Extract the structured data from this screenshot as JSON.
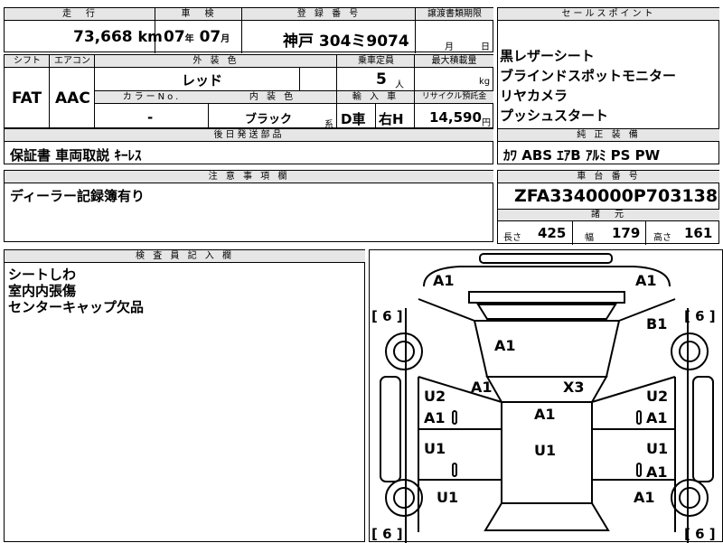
{
  "top": {
    "mileage_header": "走　行",
    "mileage_value": "73,668",
    "mileage_unit": "km",
    "inspection_header": "車　検",
    "inspection_year": "07",
    "inspection_year_unit": "年",
    "inspection_month": "07",
    "inspection_month_unit": "月",
    "registration_header": "登 録 番 号",
    "registration_value": "神戸 304ミ9074",
    "transfer_header": "譲渡書類期限",
    "transfer_month_unit": "月",
    "transfer_day_unit": "日"
  },
  "row2": {
    "shift_header": "シフト",
    "shift_value": "FAT",
    "ac_header": "エアコン",
    "ac_value": "AAC",
    "exterior_color_header": "外 装 色",
    "exterior_color_value": "レッド",
    "capacity_header": "乗車定員",
    "capacity_value": "5",
    "capacity_unit": "人",
    "max_load_header": "最大積載量",
    "max_load_unit": "kg",
    "color_no_header": "カラーNo.",
    "color_no_value": "-",
    "interior_color_header": "内 装 色",
    "interior_color_value": "ブラック",
    "interior_color_suffix": "系",
    "import_header": "輸 入 車",
    "import_value": "D車",
    "steering_value": "右H",
    "recycle_header": "リサイクル預託金",
    "recycle_value": "14,590",
    "recycle_unit": "円"
  },
  "later_parts": {
    "header": "後日発送部品",
    "value": "保証書 車両取説 ｷｰﾚｽ"
  },
  "notes": {
    "header": "注 意 事 項 欄",
    "value": "ディーラー記録簿有り"
  },
  "inspector": {
    "header": "検 査 員 記 入 欄",
    "lines": [
      "シートしわ",
      "室内内張傷",
      "センターキャップ欠品"
    ]
  },
  "sales_points": {
    "header": "セールスポイント",
    "items": [
      "黒レザーシート",
      "ブラインドスポットモニター",
      "リヤカメラ",
      "プッシュスタート"
    ]
  },
  "equipment": {
    "header": "純 正 装 備",
    "value": "ｶﾜ ABS ｴｱB ｱﾙﾐ PS PW"
  },
  "chassis": {
    "header": "車 台 番 号",
    "value": "ZFA3340000P703138"
  },
  "specs": {
    "header": "諸　元",
    "length_label": "長さ",
    "length_value": "425",
    "width_label": "幅",
    "width_value": "179",
    "height_label": "高さ",
    "height_value": "161"
  },
  "diagram": {
    "tire_left_top": "[ 6 ]",
    "tire_right_top": "[ 6 ]",
    "tire_left_bottom": "[ 6 ]",
    "tire_right_bottom": "[ 6 ]",
    "marks": {
      "front_left": "A1",
      "front_right": "A1",
      "right_fender": "B1",
      "hood": "A1",
      "left_pillar": "A1",
      "roof_x": "X3",
      "roof": "A1",
      "left_front_door_1": "U2",
      "left_front_door_2": "A1",
      "right_front_door_1": "U2",
      "right_front_door_2": "A1",
      "left_rear_door": "U1",
      "right_rear_door_1": "U1",
      "right_rear_door_2": "A1",
      "center_rear": "U1",
      "left_quarter": "U1",
      "right_quarter": "A1"
    }
  }
}
